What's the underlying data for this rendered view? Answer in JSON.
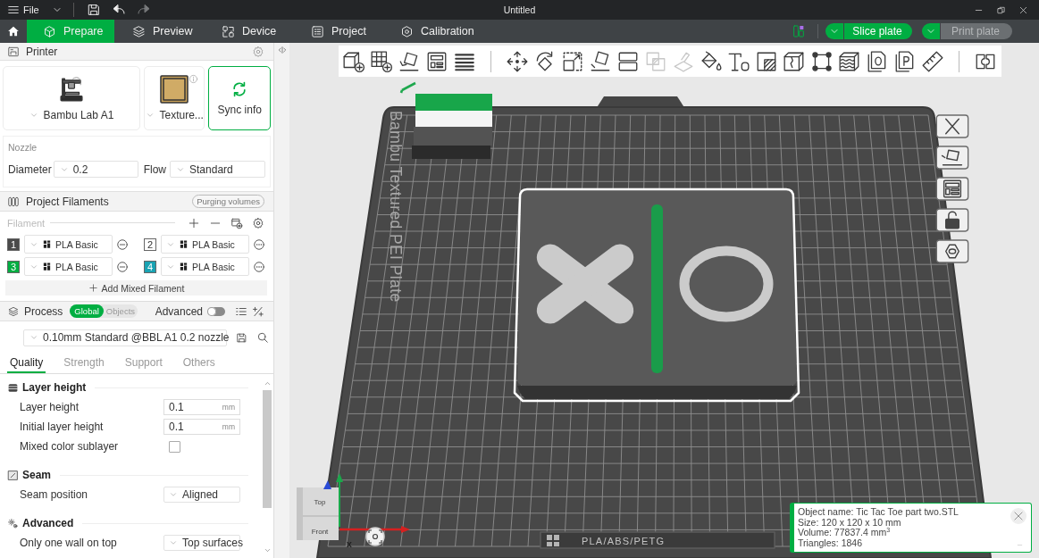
{
  "title_bar": {
    "menu_label": "File",
    "title": "Untitled",
    "actions": [
      {
        "disabled": false
      },
      {
        "disabled": false
      },
      {
        "disabled": true
      }
    ]
  },
  "tabs": [
    {
      "label": "Prepare",
      "selected": true
    },
    {
      "label": "Preview",
      "selected": false
    },
    {
      "label": "Device",
      "selected": false
    },
    {
      "label": "Project",
      "selected": false
    },
    {
      "label": "Calibration",
      "selected": false
    }
  ],
  "slice_button": {
    "label": "Slice plate",
    "disabled": false
  },
  "print_button": {
    "label": "Print plate",
    "disabled": true
  },
  "printer_panel": {
    "title": "Printer",
    "printer_name": "Bambu Lab A1",
    "plate_name": "Texture...",
    "sync_label": "Sync info",
    "nozzle": {
      "title": "Nozzle",
      "diameter_label": "Diameter",
      "diameter": "0.2",
      "flow_label": "Flow",
      "flow": "Standard"
    }
  },
  "filaments_panel": {
    "title": "Project Filaments",
    "purge_button": "Purging volumes",
    "filament_label": "Filament",
    "filaments": [
      {
        "number": "1",
        "color": "#4a4a4a",
        "name": "PLA Basic"
      },
      {
        "number": "2",
        "color": "#ffffff",
        "name": "PLA Basic"
      },
      {
        "number": "3",
        "color": "#00ae42",
        "name": "PLA Basic"
      },
      {
        "number": "4",
        "color": "#1aa3b3",
        "name": "PLA Basic"
      }
    ],
    "add_mixed": "Add Mixed Filament"
  },
  "process_panel": {
    "title": "Process",
    "scopes": [
      {
        "label": "Global",
        "selected": true
      },
      {
        "label": "Objects",
        "selected": false
      }
    ],
    "advanced_label": "Advanced",
    "advanced_on": false,
    "preset": "0.10mm Standard @BBL A1 0.2 nozzle",
    "tabs": [
      {
        "label": "Quality",
        "selected": true
      },
      {
        "label": "Strength",
        "selected": false
      },
      {
        "label": "Support",
        "selected": false
      },
      {
        "label": "Others",
        "selected": false
      }
    ],
    "groups": [
      {
        "title": "Layer height",
        "rows": [
          {
            "kind": "input",
            "label": "Layer height",
            "value": "0.1",
            "unit": "mm"
          },
          {
            "kind": "input",
            "label": "Initial layer height",
            "value": "0.1",
            "unit": "mm"
          },
          {
            "kind": "checkbox",
            "label": "Mixed color sublayer",
            "checked": false
          }
        ]
      },
      {
        "title": "Seam",
        "rows": [
          {
            "kind": "dropdown",
            "label": "Seam position",
            "value": "Aligned"
          }
        ]
      },
      {
        "title": "Advanced",
        "rows": [
          {
            "kind": "dropdown",
            "label": "Only one wall on top",
            "value": "Top surfaces"
          }
        ]
      }
    ]
  },
  "viewport": {
    "toolbar": [
      {
        "disabled": false
      },
      {
        "disabled": false
      },
      {
        "disabled": false
      },
      {
        "disabled": false
      },
      {
        "disabled": false
      },
      {
        "disabled": false
      },
      {
        "disabled": false
      },
      {
        "disabled": false
      },
      {
        "disabled": false
      },
      {
        "disabled": false
      },
      {
        "disabled": true
      },
      {
        "disabled": true
      },
      {
        "disabled": false
      },
      {
        "disabled": false
      },
      {
        "disabled": false
      },
      {
        "disabled": false
      },
      {
        "disabled": false
      },
      {
        "disabled": false
      },
      {
        "disabled": false
      },
      {
        "disabled": false
      },
      {
        "disabled": false
      },
      {
        "disabled": false
      }
    ],
    "plate_label": "Bambu Textured PEI Plate",
    "plate_material": "PLA/ABS/PETG",
    "model": {
      "selected": true
    },
    "view_cube": {
      "top": "Top",
      "front": "Front",
      "axis_label": "x"
    },
    "object_info": {
      "lines": [
        "Object name: Tic Tac Toe part two.STL",
        "Size: 120 x 120 x 10 mm",
        "Volume: 77837.4 mm$^{3}$",
        "Triangles: 1846"
      ]
    }
  }
}
